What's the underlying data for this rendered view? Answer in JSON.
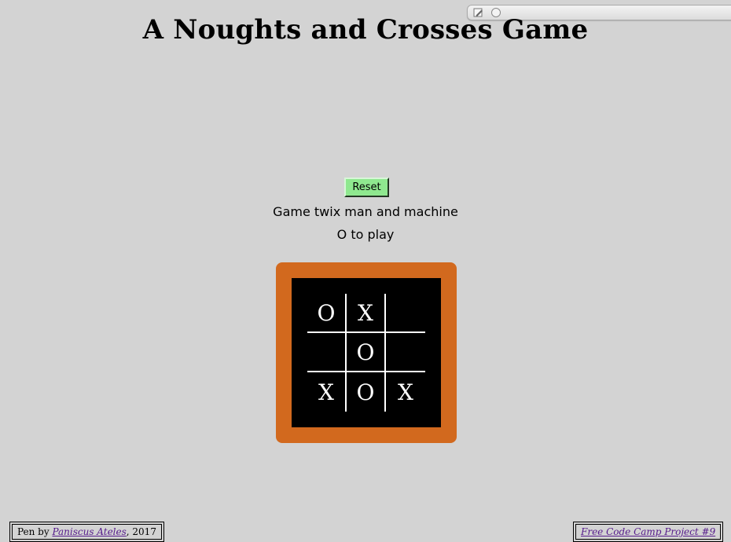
{
  "header": {
    "title": "A Noughts and Crosses Game"
  },
  "toolbar": {
    "icons": [
      "edit-icon",
      "circle-icon"
    ]
  },
  "controls": {
    "reset_label": "Reset"
  },
  "game": {
    "caption": "Game twix man and machine",
    "status": "O to play",
    "board": {
      "cells": [
        "O",
        "X",
        "",
        "",
        "O",
        "",
        "X",
        "O",
        "X"
      ]
    }
  },
  "footer": {
    "credit_prefix": "Pen by ",
    "author_name": "Paniscus Ateles",
    "credit_suffix": ", 2017",
    "project_link": "Free Code Camp Project #9"
  },
  "colors": {
    "background": "#d3d3d3",
    "board_frame": "#d2691e",
    "board_panel": "#000000",
    "board_marks": "#ffffff",
    "reset_button": "#8fe88f",
    "link": "#551a8b"
  }
}
